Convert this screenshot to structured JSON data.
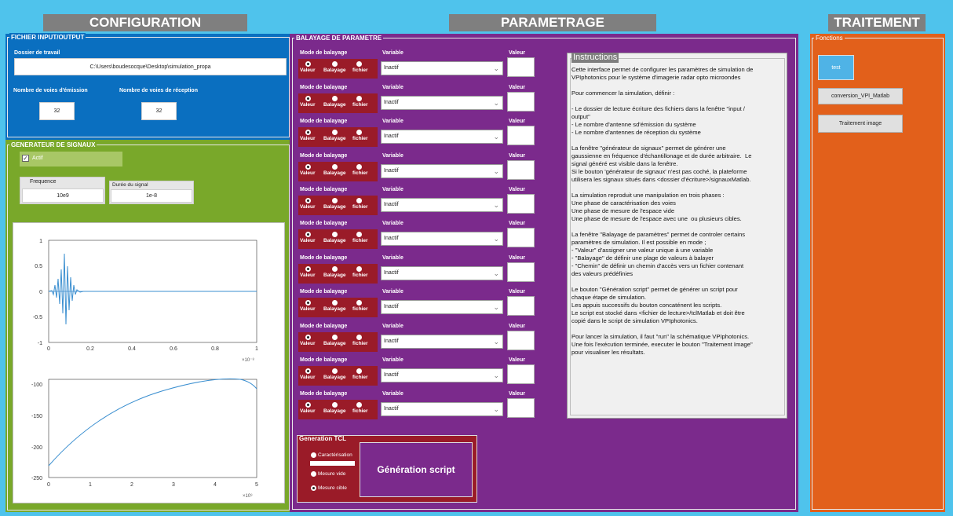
{
  "headers": {
    "config": "CONFIGURATION",
    "param": "PARAMETRAGE",
    "trait": "TRAITEMENT"
  },
  "fichier": {
    "title": "FICHIER INPUT/OUTPUT",
    "dossier_label": "Dossier de travail",
    "dossier_value": "C:\\Users\\boudesocque\\Desktop\\simulation_propa",
    "emission_label": "Nombre de voies d'émission",
    "reception_label": "Nombre de voies de réception",
    "emission_value": "32",
    "reception_value": "32"
  },
  "generateur": {
    "title": "GENERATEUR DE SIGNAUX",
    "actif_label": "Actif",
    "freq_label": "Frequence",
    "freq_value": "10e9",
    "duree_label": "Durée du signal",
    "duree_value": "1e-8"
  },
  "plot1": {
    "yticks": [
      "1",
      "0.5",
      "0",
      "-0.5",
      "-1"
    ],
    "xticks": [
      "0",
      "0.2",
      "0.4",
      "0.6",
      "0.8",
      "1"
    ],
    "xexp": "×10⁻⁸"
  },
  "plot2": {
    "yticks": [
      "-100",
      "-150",
      "-200",
      "-250"
    ],
    "xticks": [
      "0",
      "1",
      "2",
      "3",
      "4",
      "5"
    ],
    "xexp": "×10⁹"
  },
  "balayage": {
    "title": "BALAYAGE DE PARAMETRE",
    "mode_label": "Mode de balayage",
    "variable_label": "Variable",
    "valeur_label": "Valeur",
    "r1": "Valeur",
    "r2": "Balayage",
    "r3": "fichier",
    "select_value": "Inactif"
  },
  "instructions": {
    "title": "Instructions",
    "text": "Cette interface permet de configurer les paramètres de simulation de\nVPIphotonics pour le système d'imagerie radar opto microondes\n\nPour commencer la simulation, définir :\n\n- Le dossier de lecture écriture des fichiers dans la fenêtre \"input /\noutput\"\n- Le nombre d'antenne sd'émission du système\n- Le nombre d'antennes de réception du système\n\nLa fenêtre \"générateur de signaux\" permet de générer une\ngaussienne en fréquence d'échantillonage et de durée arbitraire.  Le\nsignal généré est visible dans la fenêtre.\nSi le bouton 'générateur de signaux' n'est pas coché, la plateforme\nutilisera les signaux situés dans <dossier d'écriture>/signauxMatlab.\n\nLa simulation reproduit une manipulation en trois phases :\nUne phase de caractérisation des voies\nUne phase de mesure de l'espace vide\nUne phase de mesure de l'espace avec une  ou plusieurs cibles.\n\nLa fenêtre \"Balayage de paramètres\" permet de controler certains\nparamètres de simulation. Il est possible en mode ;\n- \"Valeur\" d'assigner une valeur unique à une variable\n- \"Balayage\" de définir une plage de valeurs à balayer\n- \"Chemin\" de définir un chemin d'accès vers un fichier contenant\ndes valeurs prédéfinies\n\nLe bouton \"Génération script\" permet de générer un script pour\nchaque étape de simulation.\nLes appuis successifs du bouton concaténent les scripts.\nLe script est stocké dans <fichier de lecture>/tclMatlab et doit être\ncopié dans le script de simulation VPIphotonics.\n\nPour lancer la simulation, il faut \"run\" la schématique VPIphotonics.\nUne fois l'exécution terminée, executer le bouton \"Traitement Image\"\npour visualiser les résultats."
  },
  "tcl": {
    "title": "Generation TCL",
    "opt1": "Caractérisation",
    "opt2": "Mesure vide",
    "opt3": "Mesure cible",
    "button": "Génération script"
  },
  "fonctions": {
    "title": "Fonctions",
    "b1": "test",
    "b2": "conversion_VPI_Matlab",
    "b3": "Traitement image"
  }
}
